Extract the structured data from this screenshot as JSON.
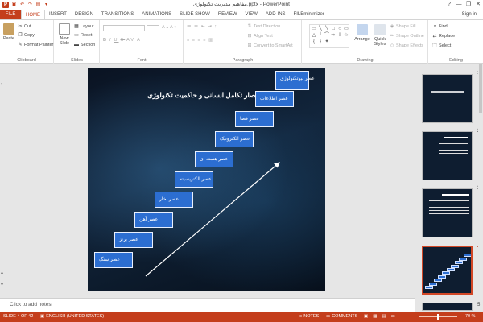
{
  "window": {
    "title": "مفاهیم مدیریت تکنولوژی.pptx - PowerPoint",
    "app_logo": "P",
    "controls": [
      "?",
      "—",
      "❐",
      "✕"
    ]
  },
  "tabs": [
    "FILE",
    "HOME",
    "INSERT",
    "DESIGN",
    "TRANSITIONS",
    "ANIMATIONS",
    "SLIDE SHOW",
    "REVIEW",
    "VIEW",
    "ADD-INS",
    "FILEminimizer"
  ],
  "active_tab": "HOME",
  "signin": "Sign in",
  "ribbon": {
    "clipboard": {
      "label": "Clipboard",
      "paste": "Paste",
      "cut": "Cut",
      "copy": "Copy",
      "format_painter": "Format Painter"
    },
    "slides": {
      "label": "Slides",
      "new_slide": "New Slide",
      "layout": "Layout",
      "reset": "Reset",
      "section": "Section"
    },
    "font": {
      "label": "Font"
    },
    "paragraph": {
      "label": "Paragraph",
      "text_direction": "Text Direction",
      "align_text": "Align Text",
      "convert_smartart": "Convert to SmartArt"
    },
    "drawing": {
      "label": "Drawing",
      "arrange": "Arrange",
      "quick_styles": "Quick Styles",
      "shape_fill": "Shape Fill",
      "shape_outline": "Shape Outline",
      "shape_effects": "Shape Effects"
    },
    "editing": {
      "label": "Editing",
      "find": "Find",
      "replace": "Replace",
      "select": "Select"
    }
  },
  "slide": {
    "title": "اعصار تکامل انسانی و حاکمیت تکنولوژی",
    "steps": [
      "عصر سنگ",
      "عصر برنز",
      "عصر آهن",
      "عصر بخار",
      "عصر الکتریسیته",
      "عصر هسته ای",
      "عصر الکترونیک",
      "عصر فضا",
      "عصر اطلاعات",
      "عصر بیوتکنولوژی"
    ]
  },
  "thumbnails": {
    "numbers": [
      "1",
      "2",
      "3",
      "4",
      "5"
    ],
    "active_index": 4
  },
  "notes": {
    "placeholder": "Click to add notes"
  },
  "status": {
    "slide": "SLIDE 4 OF 42",
    "language": "ENGLISH (UNITED STATES)",
    "notes": "NOTES",
    "comments": "COMMENTS",
    "zoom": "70 %",
    "zoom_fraction": 0.5
  },
  "colors": {
    "accent": "#c43e1c",
    "step_fill": "#2c6ed1"
  }
}
